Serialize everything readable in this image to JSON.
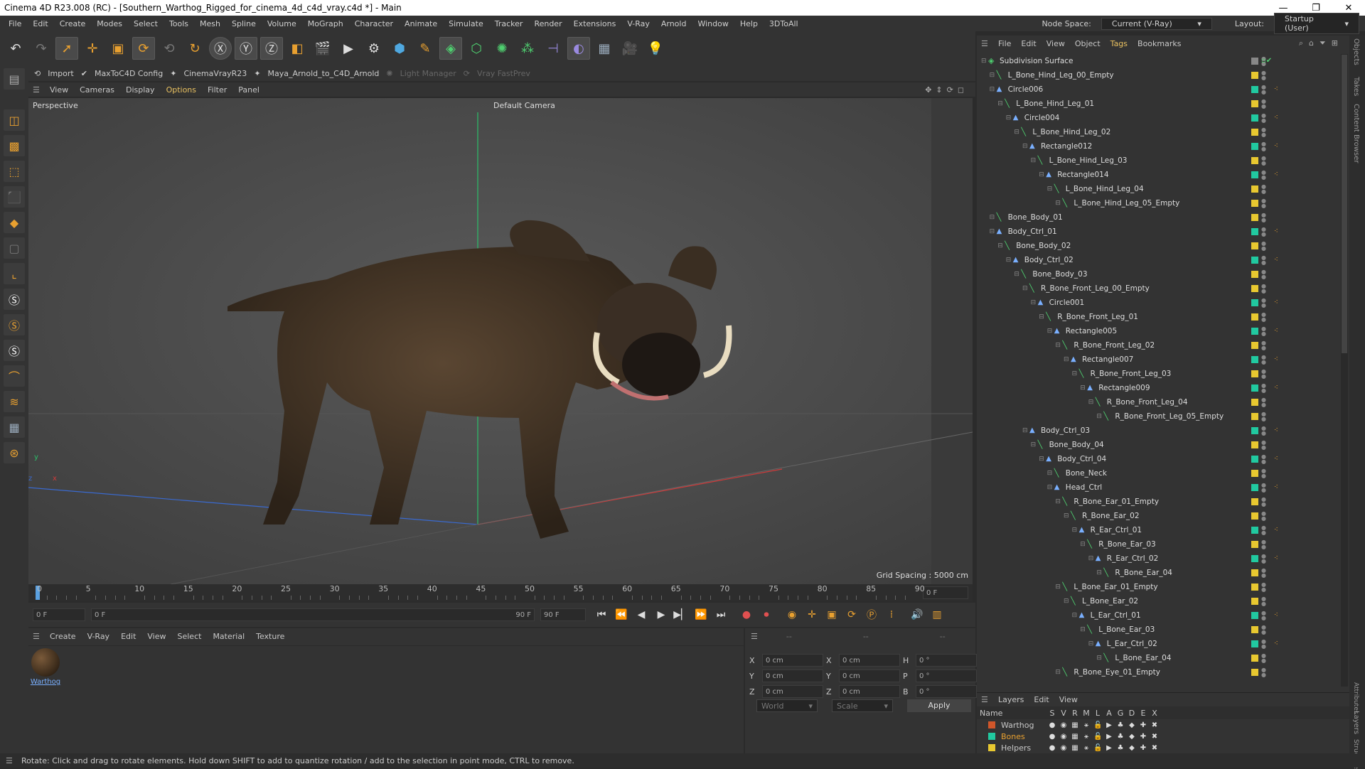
{
  "window": {
    "title": "Cinema 4D R23.008 (RC) - [Southern_Warthog_Rigged_for_cinema_4d_c4d_vray.c4d *] - Main",
    "min": "—",
    "max": "❐",
    "close": "✕"
  },
  "menu": [
    "File",
    "Edit",
    "Create",
    "Modes",
    "Select",
    "Tools",
    "Mesh",
    "Spline",
    "Volume",
    "MoGraph",
    "Character",
    "Animate",
    "Simulate",
    "Tracker",
    "Render",
    "Extensions",
    "V-Ray",
    "Arnold",
    "Window",
    "Help",
    "3DToAll"
  ],
  "nodespace": {
    "label": "Node Space:",
    "value": "Current (V-Ray)"
  },
  "layout": {
    "label": "Layout:",
    "value": "Startup (User)"
  },
  "plugins": {
    "import": "Import",
    "maxto": "MaxToC4D Config",
    "cvr": "CinemaVrayR23",
    "maya": "Maya_Arnold_to_C4D_Arnold",
    "light": "Light Manager",
    "vray": "Vray FastPrev"
  },
  "viewmenu": [
    "View",
    "Cameras",
    "Display",
    "Options",
    "Filter",
    "Panel"
  ],
  "viewport": {
    "label": "Perspective",
    "camera": "Default Camera",
    "grid": "Grid Spacing : 5000 cm"
  },
  "timeline": {
    "ticks": [
      "0",
      "5",
      "10",
      "15",
      "20",
      "25",
      "30",
      "35",
      "40",
      "45",
      "50",
      "55",
      "60",
      "65",
      "70",
      "75",
      "80",
      "85",
      "90"
    ],
    "end": "0 F"
  },
  "transport": {
    "start": "0 F",
    "cur": "0 F",
    "end": "90 F",
    "end2": "90 F"
  },
  "matmenu": [
    "Create",
    "V-Ray",
    "Edit",
    "View",
    "Select",
    "Material",
    "Texture"
  ],
  "material": {
    "name": "Warthog"
  },
  "coords": {
    "x": "X",
    "y": "Y",
    "z": "Z",
    "h": "H",
    "p": "P",
    "b": "B",
    "zero": "0 cm",
    "deg": "0 °",
    "dash": "--",
    "world": "World",
    "scale": "Scale",
    "apply": "Apply"
  },
  "status": "Rotate: Click and drag to rotate elements. Hold down SHIFT to add to quantize rotation / add to the selection in point mode, CTRL to remove.",
  "objmenu": [
    "File",
    "Edit",
    "View",
    "Object",
    "Tags",
    "Bookmarks"
  ],
  "objects": [
    [
      "Subdivision Surface",
      0,
      "sub"
    ],
    [
      "L_Bone_Hind_Leg_00_Empty",
      1,
      "bone"
    ],
    [
      "Circle006",
      1,
      "null"
    ],
    [
      "L_Bone_Hind_Leg_01",
      2,
      "bone"
    ],
    [
      "Circle004",
      3,
      "null"
    ],
    [
      "L_Bone_Hind_Leg_02",
      4,
      "bone"
    ],
    [
      "Rectangle012",
      5,
      "null"
    ],
    [
      "L_Bone_Hind_Leg_03",
      6,
      "bone"
    ],
    [
      "Rectangle014",
      7,
      "null"
    ],
    [
      "L_Bone_Hind_Leg_04",
      8,
      "bone"
    ],
    [
      "L_Bone_Hind_Leg_05_Empty",
      9,
      "bone"
    ],
    [
      "Bone_Body_01",
      1,
      "bone"
    ],
    [
      "Body_Ctrl_01",
      1,
      "null"
    ],
    [
      "Bone_Body_02",
      2,
      "bone"
    ],
    [
      "Body_Ctrl_02",
      3,
      "null"
    ],
    [
      "Bone_Body_03",
      4,
      "bone"
    ],
    [
      "R_Bone_Front_Leg_00_Empty",
      5,
      "bone"
    ],
    [
      "Circle001",
      6,
      "null"
    ],
    [
      "R_Bone_Front_Leg_01",
      7,
      "bone"
    ],
    [
      "Rectangle005",
      8,
      "null"
    ],
    [
      "R_Bone_Front_Leg_02",
      9,
      "bone"
    ],
    [
      "Rectangle007",
      10,
      "null"
    ],
    [
      "R_Bone_Front_Leg_03",
      11,
      "bone"
    ],
    [
      "Rectangle009",
      12,
      "null"
    ],
    [
      "R_Bone_Front_Leg_04",
      13,
      "bone"
    ],
    [
      "R_Bone_Front_Leg_05_Empty",
      14,
      "bone"
    ],
    [
      "Body_Ctrl_03",
      5,
      "null"
    ],
    [
      "Bone_Body_04",
      6,
      "bone"
    ],
    [
      "Body_Ctrl_04",
      7,
      "null"
    ],
    [
      "Bone_Neck",
      8,
      "bone"
    ],
    [
      "Head_Ctrl",
      8,
      "null"
    ],
    [
      "R_Bone_Ear_01_Empty",
      9,
      "bone"
    ],
    [
      "R_Bone_Ear_02",
      10,
      "bone"
    ],
    [
      "R_Ear_Ctrl_01",
      11,
      "null"
    ],
    [
      "R_Bone_Ear_03",
      12,
      "bone"
    ],
    [
      "R_Ear_Ctrl_02",
      13,
      "null"
    ],
    [
      "R_Bone_Ear_04",
      14,
      "bone"
    ],
    [
      "L_Bone_Ear_01_Empty",
      9,
      "bone"
    ],
    [
      "L_Bone_Ear_02",
      10,
      "bone"
    ],
    [
      "L_Ear_Ctrl_01",
      11,
      "null"
    ],
    [
      "L_Bone_Ear_03",
      12,
      "bone"
    ],
    [
      "L_Ear_Ctrl_02",
      13,
      "null"
    ],
    [
      "L_Bone_Ear_04",
      14,
      "bone"
    ],
    [
      "R_Bone_Eye_01_Empty",
      9,
      "bone"
    ]
  ],
  "layers": {
    "menu": [
      "Layers",
      "Edit",
      "View"
    ],
    "name_col": "Name",
    "cols": [
      "S",
      "V",
      "R",
      "M",
      "L",
      "A",
      "G",
      "D",
      "E",
      "X"
    ],
    "rows": [
      {
        "name": "Warthog",
        "color": "#d0562a"
      },
      {
        "name": "Bones",
        "color": "#21c9a0"
      },
      {
        "name": "Helpers",
        "color": "#e8c830"
      }
    ]
  },
  "sidetabs": [
    "Objects",
    "Takes",
    "Content Browser",
    "Attributes",
    "Layers",
    "Structure"
  ],
  "colors": {
    "accent": "#e8a030",
    "selected": "#e8a030"
  }
}
